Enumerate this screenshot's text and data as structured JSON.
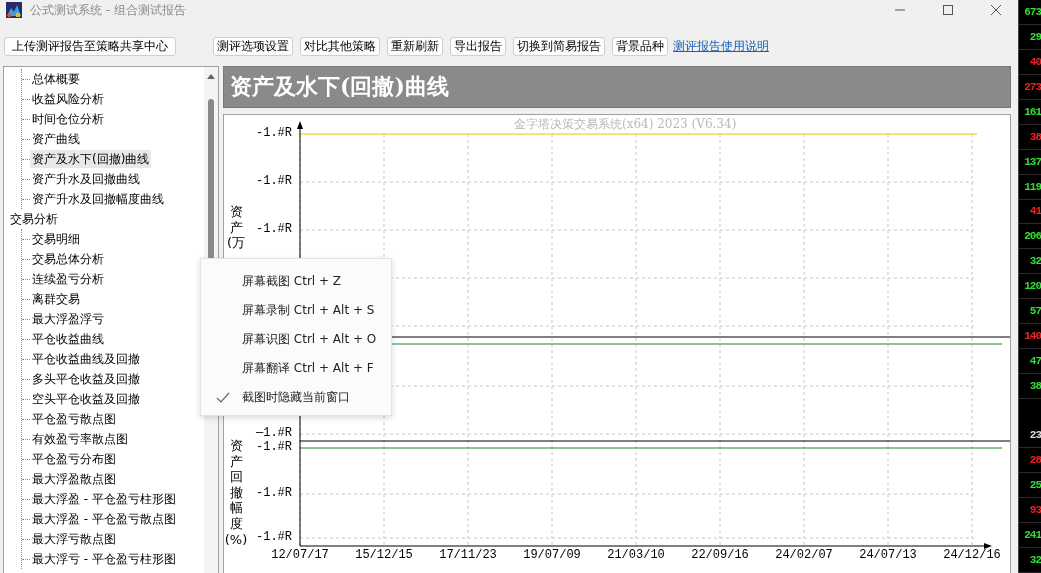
{
  "window": {
    "title": "公式测试系统 - 组合测试报告"
  },
  "toolbar": {
    "buttons": [
      "上传测评报告至策略共享中心",
      "测评选项设置",
      "对比其他策略",
      "重新刷新",
      "导出报告",
      "切换到简易报告",
      "背景品种"
    ],
    "link": "测评报告使用说明"
  },
  "tree": [
    {
      "children": [
        {
          "label": "总体概要",
          "selected": false
        },
        {
          "label": "收益风险分析",
          "selected": false
        },
        {
          "label": "时间仓位分析",
          "selected": false
        },
        {
          "label": "资产曲线",
          "selected": false
        },
        {
          "label": "资产及水下(回撤)曲线",
          "selected": true
        },
        {
          "label": "资产升水及回撤曲线",
          "selected": false
        },
        {
          "label": "资产升水及回撤幅度曲线",
          "selected": false
        }
      ]
    },
    {
      "label": "交易分析",
      "children": [
        {
          "label": "交易明细",
          "selected": false
        },
        {
          "label": "交易总体分析",
          "selected": false
        },
        {
          "label": "连续盈亏分析",
          "selected": false
        },
        {
          "label": "离群交易",
          "selected": false
        },
        {
          "label": "最大浮盈浮亏",
          "selected": false
        },
        {
          "label": "平仓收益曲线",
          "selected": false
        },
        {
          "label": "平仓收益曲线及回撤",
          "selected": false
        },
        {
          "label": "多头平仓收益及回撤",
          "selected": false
        },
        {
          "label": "空头平仓收益及回撤",
          "selected": false
        },
        {
          "label": "平仓盈亏散点图",
          "selected": false
        },
        {
          "label": "有效盈亏率散点图",
          "selected": false
        },
        {
          "label": "平仓盈亏分布图",
          "selected": false
        },
        {
          "label": "最大浮盈散点图",
          "selected": false
        },
        {
          "label": "最大浮盈 - 平仓盈亏柱形图",
          "selected": false
        },
        {
          "label": "最大浮盈 - 平仓盈亏散点图",
          "selected": false
        },
        {
          "label": "最大浮亏散点图",
          "selected": false
        },
        {
          "label": "最大浮亏 - 平仓盈亏柱形图",
          "selected": false
        }
      ]
    }
  ],
  "section": {
    "title": "资产及水下(回撤)曲线"
  },
  "chart": {
    "watermark": "金字塔决策交易系统(x64) 2023 (V6.34)",
    "ylabel_top": "资产(万",
    "ylabel_bottom": "资产回撤幅度(%)",
    "yticks_top": [
      "-1.#R",
      "-1.#R",
      "-1.#R"
    ],
    "yticks_bottom": [
      "—1.#R",
      "-1.#R",
      "-1.#R",
      "-1.#R"
    ],
    "xticks": [
      "12/07/17",
      "15/12/15",
      "17/11/23",
      "19/07/09",
      "21/03/10",
      "22/09/16",
      "24/02/07",
      "24/07/13",
      "24/12/16"
    ]
  },
  "context_menu": [
    {
      "label": "屏幕截图 Ctrl + Z",
      "checked": false
    },
    {
      "label": "屏幕录制 Ctrl + Alt + S",
      "checked": false
    },
    {
      "label": "屏幕识图 Ctrl + Alt + O",
      "checked": false
    },
    {
      "label": "屏幕翻译 Ctrl + Alt + F",
      "checked": false
    },
    {
      "label": "截图时隐藏当前窗口",
      "checked": true
    }
  ],
  "side_quotes": [
    {
      "text": "673",
      "color": "#33dd33",
      "gap_before": false
    },
    {
      "text": "29",
      "color": "#33dd33",
      "gap_before": false
    },
    {
      "text": "40",
      "color": "#ee2222",
      "gap_before": false
    },
    {
      "text": "273",
      "color": "#ee2222",
      "gap_before": false
    },
    {
      "text": "161",
      "color": "#33dd33",
      "gap_before": false
    },
    {
      "text": "38",
      "color": "#ee2222",
      "gap_before": false
    },
    {
      "text": "137",
      "color": "#33dd33",
      "gap_before": false
    },
    {
      "text": "119",
      "color": "#33dd33",
      "gap_before": false
    },
    {
      "text": "41",
      "color": "#ee2222",
      "gap_before": false
    },
    {
      "text": "206",
      "color": "#33dd33",
      "gap_before": false
    },
    {
      "text": "32",
      "color": "#33dd33",
      "gap_before": false
    },
    {
      "text": "120",
      "color": "#33dd33",
      "gap_before": false
    },
    {
      "text": "57",
      "color": "#33dd33",
      "gap_before": false
    },
    {
      "text": "140",
      "color": "#ee2222",
      "gap_before": false
    },
    {
      "text": "47",
      "color": "#33dd33",
      "gap_before": false
    },
    {
      "text": "38",
      "color": "#33dd33",
      "gap_before": false
    },
    {
      "text": "23",
      "color": "#dddddd",
      "gap_before": true
    },
    {
      "text": "28",
      "color": "#ee2222",
      "gap_before": false
    },
    {
      "text": "25",
      "color": "#33dd33",
      "gap_before": false
    },
    {
      "text": "93",
      "color": "#ee2222",
      "gap_before": false
    },
    {
      "text": "241",
      "color": "#33dd33",
      "gap_before": false
    },
    {
      "text": "32",
      "color": "#33dd33",
      "gap_before": false
    }
  ]
}
